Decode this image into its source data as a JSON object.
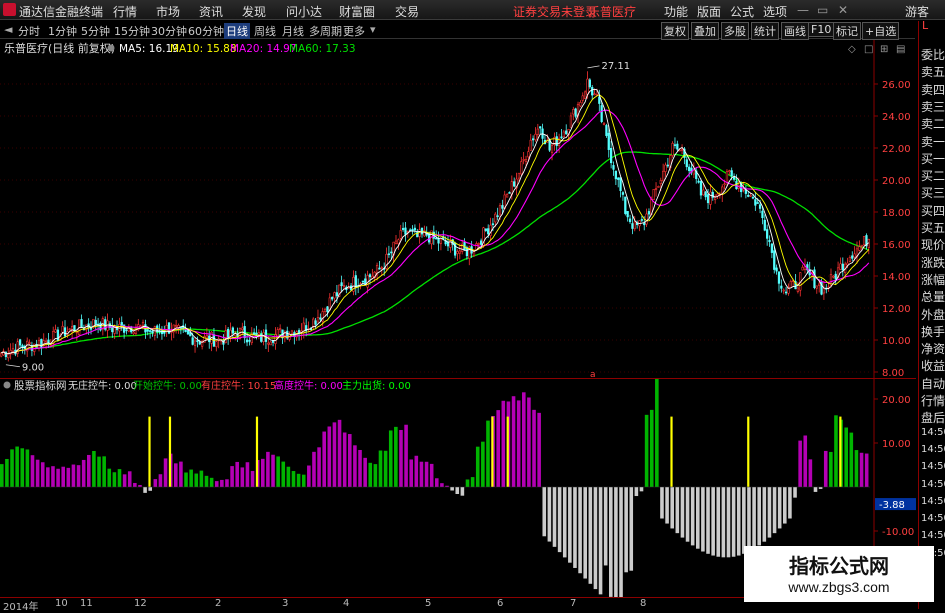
{
  "app": {
    "title": "通达信金融终端",
    "menu": [
      "行情",
      "市场",
      "资讯",
      "发现",
      "问小达",
      "财富圈",
      "交易"
    ],
    "notice": "证券交易未登录",
    "stock_name": "乐普医疗",
    "right_menu": [
      "功能",
      "版面",
      "公式",
      "选项"
    ],
    "guest": "游客"
  },
  "toolbar": {
    "periods": [
      "分时",
      "1分钟",
      "5分钟",
      "15分钟",
      "30分钟",
      "60分钟",
      "日线",
      "周线",
      "月线",
      "多周期",
      "更多"
    ],
    "active_period": "日线",
    "right_buttons": [
      "复权",
      "叠加",
      "多股",
      "统计",
      "画线",
      "F10",
      "标记",
      "+自选"
    ],
    "badge": "L"
  },
  "side_panel": [
    "委比",
    "卖五",
    "卖四",
    "卖三",
    "卖二",
    "卖一",
    "买一",
    "买二",
    "买三",
    "买四",
    "买五",
    "现价",
    "涨跌",
    "涨幅",
    "总量",
    "外盘",
    "换手",
    "净资",
    "收益",
    "自动",
    "行情",
    "盘后",
    "14:50",
    "14:50",
    "14:50",
    "14:50",
    "14:50",
    "14:50",
    "14:50",
    "14:50"
  ],
  "main_chart": {
    "title": "乐普医疗(日线 前复权)",
    "ma_labels": [
      "MA5: 16.19",
      "MA10: 15.88",
      "MA20: 14.97",
      "MA60: 17.33"
    ],
    "ma_colors": [
      "#ffffff",
      "#ffff00",
      "#ff00ff",
      "#00e000"
    ],
    "high_label": "27.11",
    "low_label": "9.00",
    "marker": "a",
    "y_ticks": [
      "26.00",
      "24.00",
      "22.00",
      "20.00",
      "18.00",
      "16.00",
      "14.00",
      "12.00",
      "10.00",
      "8.00"
    ]
  },
  "indicator": {
    "title": "股票指标网",
    "items": [
      {
        "label": "无庄控牛: 0.00",
        "color": "#dddddd"
      },
      {
        "label": "开始控牛: 0.00",
        "color": "#00c000"
      },
      {
        "label": "有庄控牛: 10.15",
        "color": "#ff4040"
      },
      {
        "label": "高度控牛: 0.00",
        "color": "#ff00ff"
      },
      {
        "label": "主力出货: 0.00",
        "color": "#00ff00"
      }
    ],
    "y_ticks": [
      "20.00",
      "10.00",
      "-10.00",
      "-20.00"
    ],
    "current": "-3.88"
  },
  "dates": [
    "2014年",
    "10",
    "11",
    "12",
    "2",
    "3",
    "4",
    "5",
    "6",
    "7",
    "8"
  ],
  "watermark": {
    "line1": "指标公式网",
    "line2": "www.zbgs3.com"
  },
  "chart_data": {
    "type": "candlestick",
    "ylim": [
      8,
      27.5
    ],
    "close": [
      9.2,
      9.4,
      9.6,
      9.7,
      9.8,
      10.0,
      10.3,
      10.6,
      10.8,
      10.9,
      11.1,
      10.9,
      10.7,
      10.8,
      10.9,
      10.7,
      10.5,
      10.6,
      10.8,
      10.4,
      10.2,
      10.0,
      10.1,
      10.0,
      10.2,
      10.5,
      10.3,
      10.1,
      10.2,
      10.3,
      10.5,
      10.6,
      10.8,
      11.2,
      11.8,
      12.6,
      13.2,
      13.5,
      13.8,
      14.0,
      14.4,
      15.2,
      16.3,
      16.8,
      16.4,
      16.6,
      16.2,
      16.0,
      15.7,
      15.5,
      15.8,
      16.6,
      17.5,
      18.4,
      19.6,
      20.8,
      22.5,
      23.4,
      21.9,
      22.7,
      23.5,
      24.7,
      26.1,
      25.0,
      22.5,
      20.4,
      18.1,
      17.0,
      17.4,
      19.0,
      20.5,
      22.0,
      21.8,
      20.6,
      19.1,
      18.9,
      19.5,
      20.3,
      19.7,
      19.2,
      18.5,
      16.8,
      14.2,
      13.0,
      13.5,
      14.3,
      13.7,
      13.1,
      13.9,
      14.8,
      15.5,
      15.9,
      16.6
    ]
  }
}
